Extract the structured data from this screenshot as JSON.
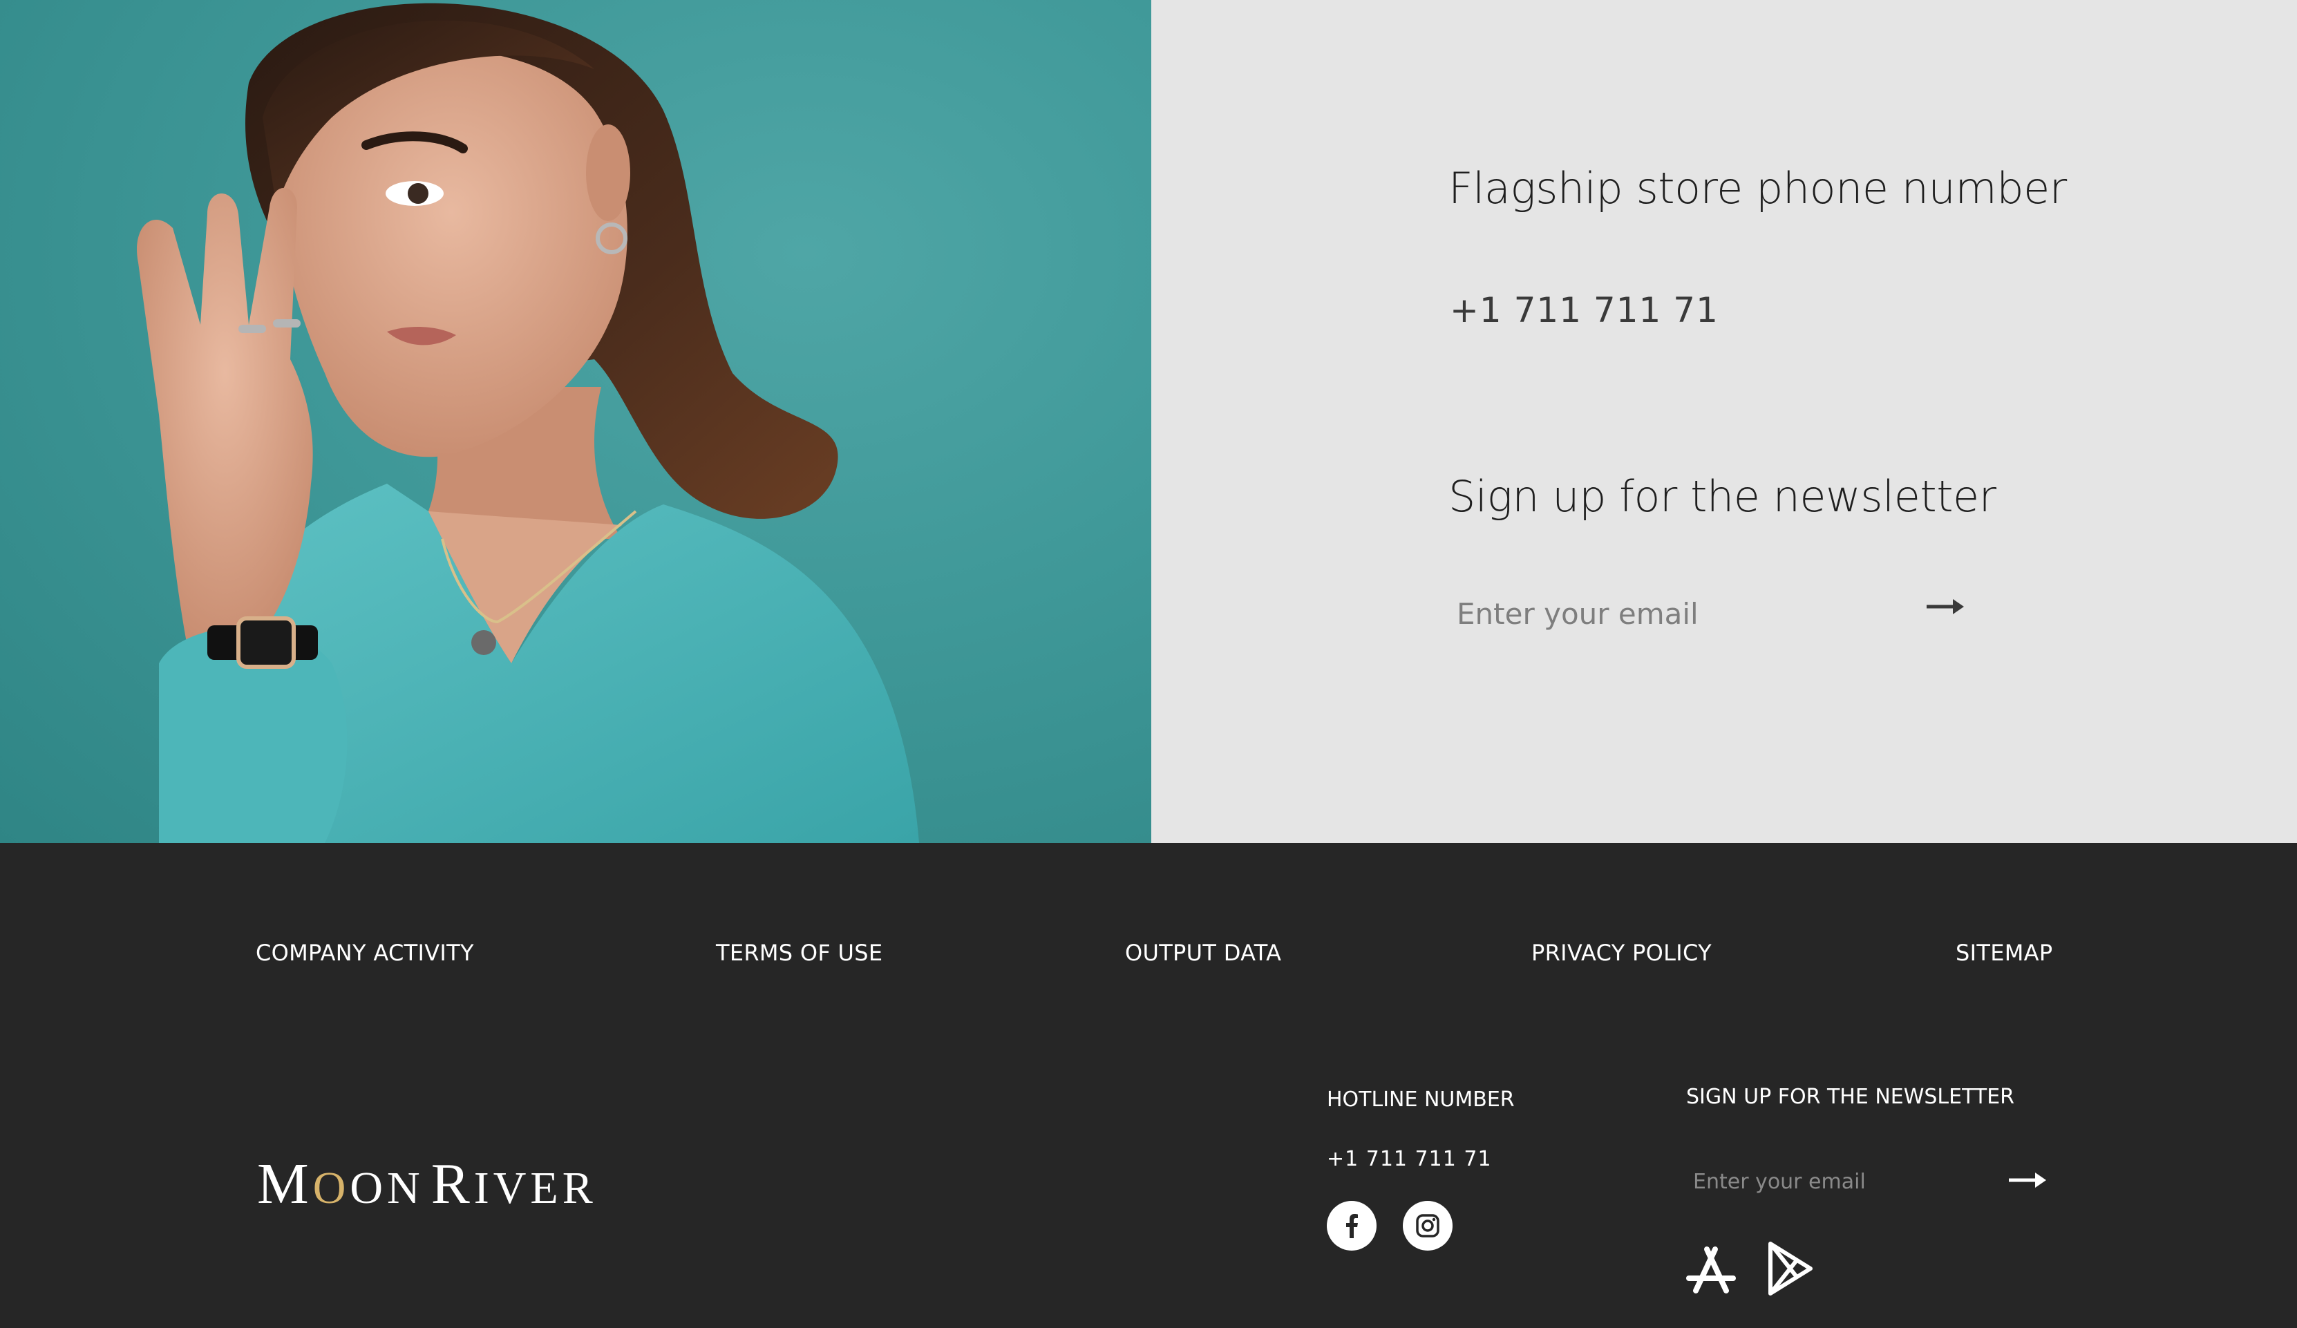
{
  "hero": {
    "image_alt": "Woman in turquoise blouse wearing rings, necklace, earrings and wristwatch",
    "phone_title": "Flagship store phone number",
    "phone_number": "+1 711 711 71",
    "newsletter_title": "Sign up for the newsletter",
    "email_placeholder": "Enter your email",
    "submit_icon": "arrow-right-icon"
  },
  "footer": {
    "links": [
      {
        "label": "COMPANY ACTIVITY"
      },
      {
        "label": "TERMS OF USE"
      },
      {
        "label": "OUTPUT DATA"
      },
      {
        "label": "PRIVACY POLICY"
      },
      {
        "label": "SITEMAP"
      }
    ],
    "logo": {
      "first_word_initial": "M",
      "first_word_o": "O",
      "first_word_rest": "ON",
      "second_word_initial": "R",
      "second_word_rest": "IVER",
      "accent_color": "#d7b36a"
    },
    "hotline": {
      "title": "HOTLINE NUMBER",
      "number": "+1 711 711 71"
    },
    "social": [
      "facebook-icon",
      "instagram-icon"
    ],
    "newsletter": {
      "title": "SIGN UP FOR THE NEWSLETTER",
      "email_placeholder": "Enter your email",
      "submit_icon": "arrow-right-icon"
    },
    "apps": [
      "app-store-icon",
      "google-play-icon"
    ]
  },
  "colors": {
    "teal_background": "#3f9898",
    "panel_background": "#e5e5e5",
    "footer_background": "#262626",
    "text_dark": "#1f1f1f",
    "text_light": "#ffffff"
  }
}
